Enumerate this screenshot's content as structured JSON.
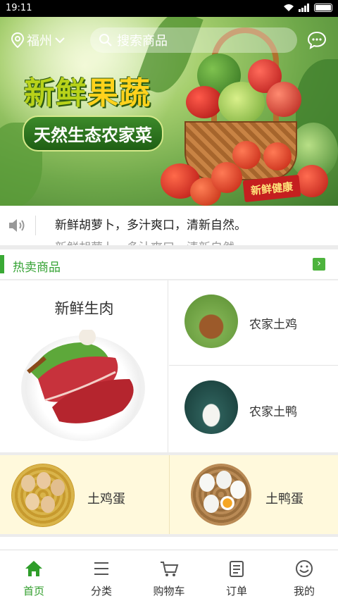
{
  "status_bar": {
    "time": "19:11"
  },
  "header": {
    "city": "福州",
    "search_placeholder": "搜索商品"
  },
  "banner": {
    "slogan_main_1": "新鲜",
    "slogan_main_2": "果蔬",
    "slogan_sub": "天然生态农家菜",
    "badge": "新鲜健康"
  },
  "notice": {
    "line1": "新鲜胡萝卜，多汁爽口，清新自然。",
    "line2": "新鲜胡萝卜，多汁爽口，清新自然。"
  },
  "section": {
    "title": "热卖商品",
    "more_glyph": "›"
  },
  "products": {
    "featured": "新鲜生肉",
    "item_chicken": "农家土鸡",
    "item_duck": "农家土鸭",
    "item_chicken_egg": "土鸡蛋",
    "item_duck_egg": "土鸭蛋"
  },
  "tabs": [
    {
      "label": "首页",
      "icon": "home-icon",
      "active": true
    },
    {
      "label": "分类",
      "icon": "list-icon",
      "active": false
    },
    {
      "label": "购物车",
      "icon": "cart-icon",
      "active": false
    },
    {
      "label": "订单",
      "icon": "order-icon",
      "active": false
    },
    {
      "label": "我的",
      "icon": "smile-icon",
      "active": false
    }
  ],
  "colors": {
    "accent": "#2f9d2a",
    "section_bar": "#3aa935",
    "egg_row_bg": "#fff9dc"
  }
}
